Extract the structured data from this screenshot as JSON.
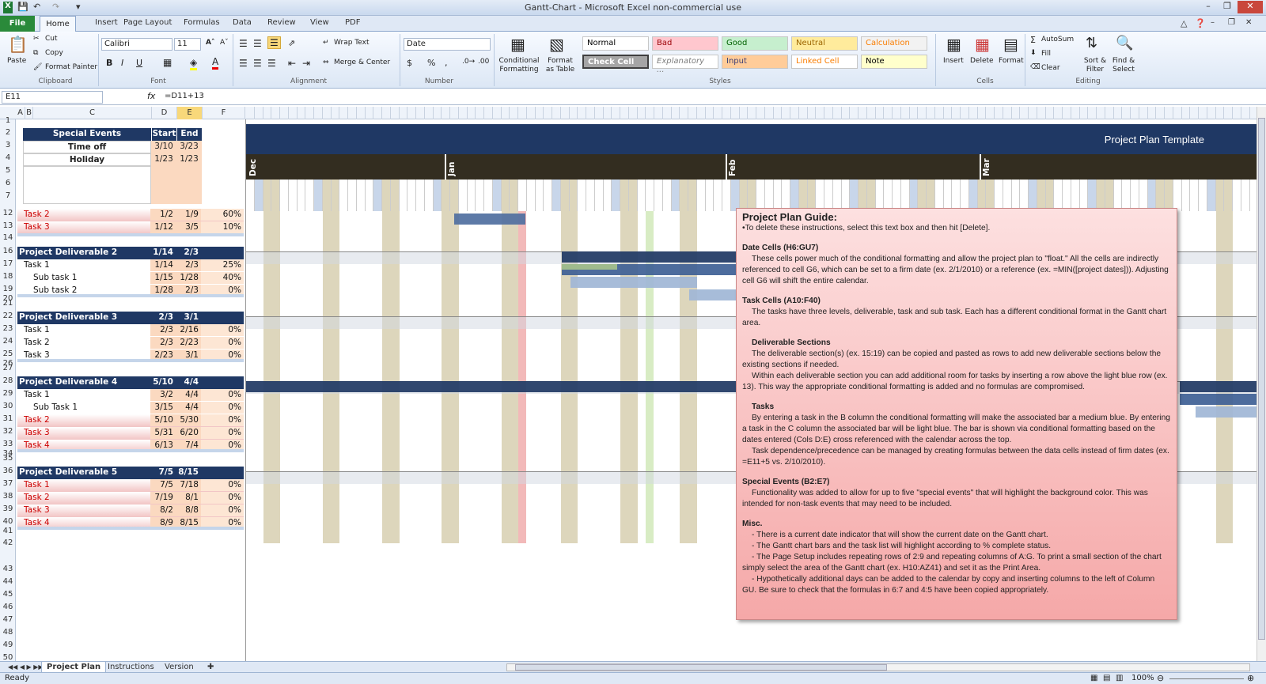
{
  "window": {
    "title": "Gantt-Chart - Microsoft Excel non-commercial use"
  },
  "ribbon_tabs": [
    "File",
    "Home",
    "Insert",
    "Page Layout",
    "Formulas",
    "Data",
    "Review",
    "View",
    "PDF"
  ],
  "clipboard": {
    "paste": "Paste",
    "cut": "Cut",
    "copy": "Copy",
    "format_painter": "Format Painter",
    "group": "Clipboard"
  },
  "font": {
    "name": "Calibri",
    "size": "11",
    "group": "Font"
  },
  "alignment": {
    "wrap": "Wrap Text",
    "merge": "Merge & Center",
    "group": "Alignment"
  },
  "number": {
    "format": "Date",
    "group": "Number"
  },
  "styles": {
    "conditional": "Conditional Formatting",
    "format_table": "Format as Table",
    "group": "Styles",
    "cells": [
      {
        "label": "Normal",
        "bg": "#ffffff",
        "fg": "#000000"
      },
      {
        "label": "Bad",
        "bg": "#ffc7ce",
        "fg": "#9c0006"
      },
      {
        "label": "Good",
        "bg": "#c6efce",
        "fg": "#006100"
      },
      {
        "label": "Neutral",
        "bg": "#ffeb9c",
        "fg": "#9c6500"
      },
      {
        "label": "Calculation",
        "bg": "#f2f2f2",
        "fg": "#fa7d00"
      },
      {
        "label": "Check Cell",
        "bg": "#a5a5a5",
        "fg": "#ffffff"
      },
      {
        "label": "Explanatory ...",
        "bg": "#ffffff",
        "fg": "#7f7f7f"
      },
      {
        "label": "Input",
        "bg": "#ffcc99",
        "fg": "#3f3f76"
      },
      {
        "label": "Linked Cell",
        "bg": "#ffffff",
        "fg": "#fa7d00"
      },
      {
        "label": "Note",
        "bg": "#ffffcc",
        "fg": "#000000"
      }
    ]
  },
  "cells_group": {
    "insert": "Insert",
    "delete": "Delete",
    "format": "Format",
    "group": "Cells"
  },
  "editing": {
    "autosum": "AutoSum",
    "fill": "Fill",
    "clear": "Clear",
    "sort": "Sort & Filter",
    "find": "Find & Select",
    "group": "Editing"
  },
  "formula_bar": {
    "name_box": "E11",
    "fx": "fx",
    "formula": "=D11+13"
  },
  "columns": [
    "A",
    "B",
    "C",
    "D",
    "E",
    "F"
  ],
  "special_events": {
    "title": "Special Events",
    "start": "Start",
    "end": "End",
    "rows": [
      {
        "name": "Time off",
        "start": "3/10",
        "end": "3/23"
      },
      {
        "name": "Holiday",
        "start": "1/23",
        "end": "1/23"
      }
    ]
  },
  "gantt": {
    "title": "Project Plan Template",
    "months": [
      "Dec",
      "Jan",
      "Feb",
      "Mar"
    ]
  },
  "tasks": [
    {
      "row": "12",
      "name": "Task 2",
      "start": "1/2",
      "end": "1/9",
      "pct": "60%",
      "style": "pink",
      "indent": 1
    },
    {
      "row": "13",
      "name": "Task 3",
      "start": "1/12",
      "end": "3/5",
      "pct": "10%",
      "style": "pink",
      "indent": 1
    },
    {
      "row": "16",
      "name": "Project Deliverable 2",
      "start": "1/14",
      "end": "2/3",
      "pct": "",
      "style": "hdr",
      "indent": 0
    },
    {
      "row": "17",
      "name": "Task 1",
      "start": "1/14",
      "end": "2/3",
      "pct": "25%",
      "style": "plain",
      "indent": 1
    },
    {
      "row": "18",
      "name": "Sub task 1",
      "start": "1/15",
      "end": "1/28",
      "pct": "40%",
      "style": "plain",
      "indent": 2
    },
    {
      "row": "19",
      "name": "Sub task 2",
      "start": "1/28",
      "end": "2/3",
      "pct": "0%",
      "style": "plain",
      "indent": 2
    },
    {
      "row": "22",
      "name": "Project Deliverable 3",
      "start": "2/3",
      "end": "3/1",
      "pct": "",
      "style": "hdr",
      "indent": 0
    },
    {
      "row": "23",
      "name": "Task 1",
      "start": "2/3",
      "end": "2/16",
      "pct": "0%",
      "style": "plain",
      "indent": 1
    },
    {
      "row": "24",
      "name": "Task 2",
      "start": "2/3",
      "end": "2/23",
      "pct": "0%",
      "style": "plain",
      "indent": 1
    },
    {
      "row": "25",
      "name": "Task 3",
      "start": "2/23",
      "end": "3/1",
      "pct": "0%",
      "style": "plain",
      "indent": 1
    },
    {
      "row": "28",
      "name": "Project Deliverable 4",
      "start": "5/10",
      "end": "4/4",
      "pct": "",
      "style": "hdr",
      "indent": 0
    },
    {
      "row": "29",
      "name": "Task 1",
      "start": "3/2",
      "end": "4/4",
      "pct": "0%",
      "style": "plain",
      "indent": 1
    },
    {
      "row": "30",
      "name": "Sub Task 1",
      "start": "3/15",
      "end": "4/4",
      "pct": "0%",
      "style": "plain",
      "indent": 2
    },
    {
      "row": "31",
      "name": "Task 2",
      "start": "5/10",
      "end": "5/30",
      "pct": "0%",
      "style": "pink",
      "indent": 1
    },
    {
      "row": "32",
      "name": "Task 3",
      "start": "5/31",
      "end": "6/20",
      "pct": "0%",
      "style": "pink",
      "indent": 1
    },
    {
      "row": "33",
      "name": "Task 4",
      "start": "6/13",
      "end": "7/4",
      "pct": "0%",
      "style": "pink",
      "indent": 1
    },
    {
      "row": "36",
      "name": "Project Deliverable 5",
      "start": "7/5",
      "end": "8/15",
      "pct": "",
      "style": "hdr",
      "indent": 0
    },
    {
      "row": "37",
      "name": "Task 1",
      "start": "7/5",
      "end": "7/18",
      "pct": "0%",
      "style": "pink",
      "indent": 1
    },
    {
      "row": "38",
      "name": "Task 2",
      "start": "7/19",
      "end": "8/1",
      "pct": "0%",
      "style": "pink",
      "indent": 1
    },
    {
      "row": "39",
      "name": "Task 3",
      "start": "8/2",
      "end": "8/8",
      "pct": "0%",
      "style": "pink",
      "indent": 1
    },
    {
      "row": "40",
      "name": "Task 4",
      "start": "8/9",
      "end": "8/15",
      "pct": "0%",
      "style": "pink",
      "indent": 1
    }
  ],
  "guide": {
    "title": "Project Plan Guide:",
    "intro": "•To delete these instructions, select this text box and then hit [Delete].",
    "date_head": "Date Cells (H6:GU7)",
    "date_text": "These cells power much of the conditional formatting and allow the project plan to \"float.\" All the cells are indirectly referenced to cell G6, which can be set to a firm date (ex. 2/1/2010) or a reference (ex. =MIN([project dates])). Adjusting cell G6 will shift the entire calendar.",
    "task_head": "Task Cells (A10:F40)",
    "task_text": "The tasks have three levels, deliverable, task and sub task. Each has a different conditional format in the Gantt chart area.",
    "deliv_head": "Deliverable Sections",
    "deliv_text1": "The deliverable section(s) (ex. 15:19) can be copied and pasted as rows to add new deliverable sections below the existing sections if needed.",
    "deliv_text2": "Within each deliverable section you can add additional room for tasks by inserting a row above the light blue row (ex. 13). This way the appropriate conditional formatting is added and no formulas are compromised.",
    "tasks_head": "Tasks",
    "tasks_text1": "By entering a task in the B column the conditional formatting will make the associated bar a medium blue. By entering a task in the C column the associated bar will be light blue. The bar is shown via conditional formatting based on the dates entered (Cols D:E) cross referenced with the calendar across the top.",
    "tasks_text2": "Task dependence/precedence can be managed by creating formulas between the data cells instead of firm dates (ex. =E11+5 vs. 2/10/2010).",
    "special_head": "Special Events (B2:E7)",
    "special_text": "Functionality was added to allow for up to five \"special events\" that will highlight the background color. This was intended for non-task events that may need to be included.",
    "misc_head": "Misc.",
    "misc1": "- There is a current date indicator that will show the current date on the Gantt chart.",
    "misc2": "- The Gantt chart bars and the task list will highlight according to % complete status.",
    "misc3": "- The Page Setup includes repeating rows of 2:9 and repeating columns of A:G. To print a small section of the chart simply select the area of the Gantt chart (ex. H10:AZ41) and set it as the Print Area.",
    "misc4": "- Hypothetically additional days can be added to the calendar by copy and inserting columns to the left of Column GU. Be sure to check that the formulas in 6:7 and 4:5 have been copied appropriately."
  },
  "sheets": [
    "Project Plan",
    "Instructions",
    "Version"
  ],
  "status": {
    "ready": "Ready",
    "zoom": "100%"
  }
}
